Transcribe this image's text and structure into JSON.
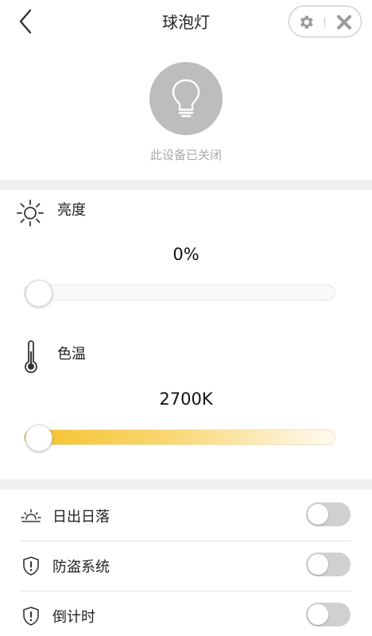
{
  "header": {
    "title": "球泡灯"
  },
  "device": {
    "status": "此设备已关闭"
  },
  "brightness": {
    "label": "亮度",
    "value_text": "0%",
    "value": 0
  },
  "color_temp": {
    "label": "色温",
    "value_text": "2700K",
    "value": 0
  },
  "settings": {
    "items": [
      {
        "label": "日出日落",
        "icon": "sunrise-icon",
        "on": false
      },
      {
        "label": "防盗系统",
        "icon": "shield-alert-icon",
        "on": false
      },
      {
        "label": "倒计时",
        "icon": "shield-alert-icon",
        "on": false
      }
    ]
  },
  "colors": {
    "slider_gradient_start": "#f5c229",
    "toggle_off": "#d0d0d0",
    "bulb_off": "#bdbdbd"
  }
}
